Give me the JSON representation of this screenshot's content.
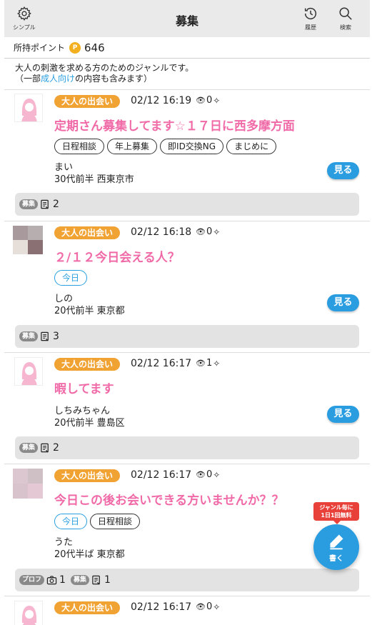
{
  "header": {
    "title": "募集",
    "simple_label": "シンプル",
    "history_label": "履歴",
    "search_label": "検索"
  },
  "points": {
    "label": "所持ポイント",
    "icon_letter": "P",
    "value": "646"
  },
  "genre_desc": {
    "line1": "大人の刺激を求める方のためのジャンルです。",
    "line2_prefix": "（一部",
    "line2_link": "成人向け",
    "line2_suffix": "の内容も含みます）"
  },
  "posts": [
    {
      "genre": "大人の出会い",
      "date": "02/12 16:19",
      "views": "0",
      "title": "定期さん募集してます☆１７日に西多摩方面",
      "tags": [
        "日程相談",
        "年上募集",
        "即ID交換NG",
        "まじめに"
      ],
      "name": "まい",
      "info": "30代前半 西東京市",
      "see_label": "見る",
      "footer_badge": "募集",
      "footer_count": "2",
      "avatar": "girl-icon"
    },
    {
      "genre": "大人の出会い",
      "date": "02/12 16:18",
      "views": "0",
      "title": "２/１２今日会える人？",
      "tags": [
        "今日"
      ],
      "name": "しの",
      "info": "20代前半 東京都",
      "see_label": "見る",
      "footer_badge": "募集",
      "footer_count": "3",
      "avatar": "mosaic-photo"
    },
    {
      "genre": "大人の出会い",
      "date": "02/12 16:17",
      "views": "1",
      "title": "暇してます",
      "tags": [],
      "name": "しちみちゃん",
      "info": "20代前半 豊島区",
      "see_label": "見る",
      "footer_badge": "募集",
      "footer_count": "2",
      "avatar": "girl-icon"
    },
    {
      "genre": "大人の出会い",
      "date": "02/12 16:17",
      "views": "0",
      "title": "今日この後お会いできる方いませんか？？",
      "tags": [
        "今日",
        "日程相談"
      ],
      "name": "うた",
      "info": "20代半ば 東京都",
      "see_label": "見る",
      "footer_profile_badge": "プロフ",
      "footer_photo_count": "1",
      "footer_badge": "募集",
      "footer_count": "1",
      "avatar": "mosaic-photo"
    },
    {
      "genre": "大人の出会い",
      "date": "02/12 16:17",
      "views": "0",
      "avatar": "girl-icon"
    }
  ],
  "fab": {
    "tip_line1": "ジャンル毎に",
    "tip_line2": "1日1回無料",
    "label": "書く"
  },
  "colors": {
    "accent_blue": "#2a9de0",
    "genre_orange": "#f0a233",
    "title_pink": "#f16aa8",
    "header_gray": "#eaeaea",
    "tip_red": "#e8413a"
  }
}
